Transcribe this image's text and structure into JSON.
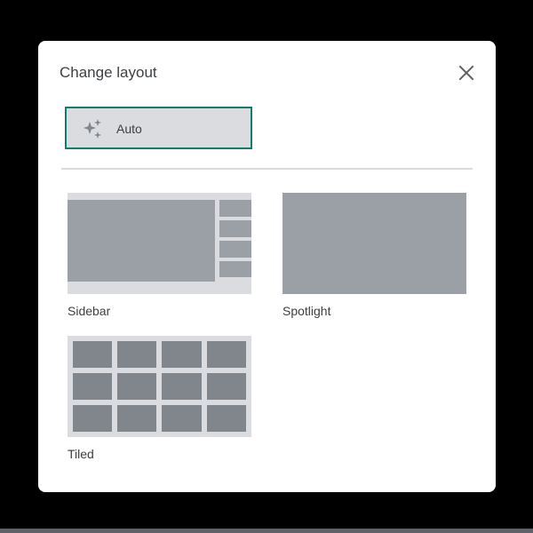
{
  "dialog": {
    "title": "Change layout",
    "close_label": "Close"
  },
  "options": {
    "auto": {
      "label": "Auto",
      "selected": true
    },
    "sidebar": {
      "label": "Sidebar"
    },
    "spotlight": {
      "label": "Spotlight"
    },
    "tiled": {
      "label": "Tiled"
    }
  },
  "icons": {
    "auto": "sparkle-icon",
    "close": "close-icon"
  },
  "colors": {
    "accent": "#137b6f",
    "preview_bg": "#dadce0",
    "block": "#9aa0a6",
    "tile": "#80868b"
  }
}
